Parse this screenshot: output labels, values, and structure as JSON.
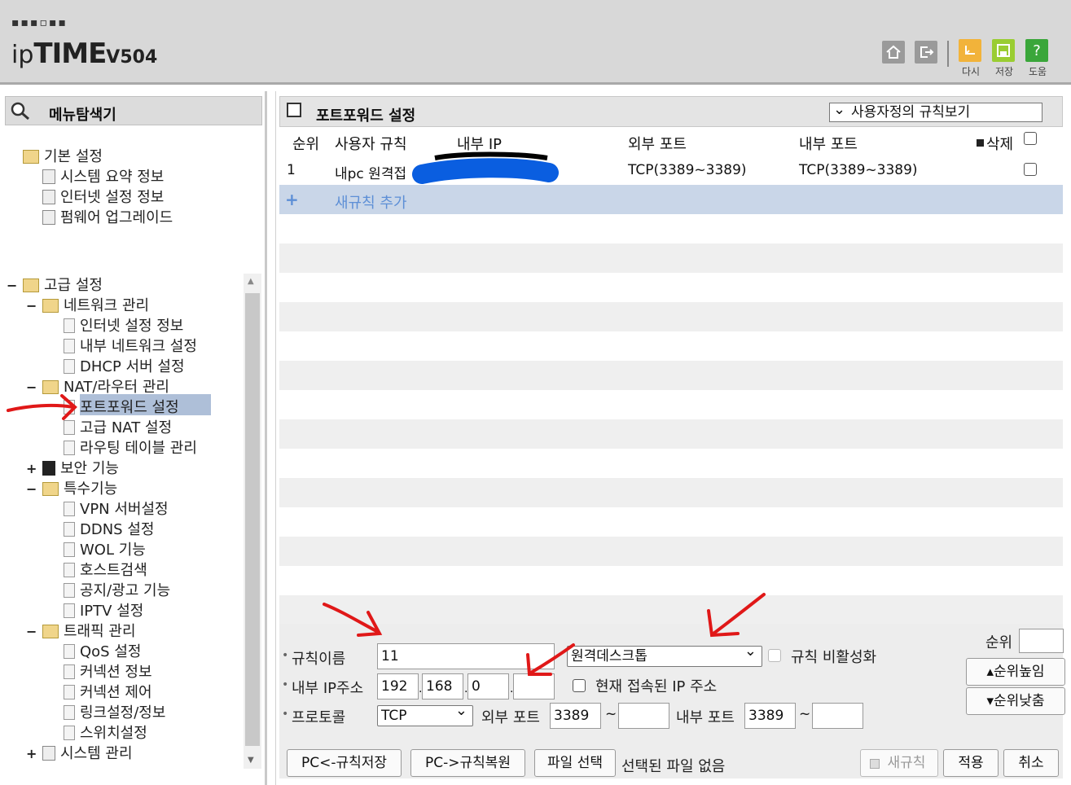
{
  "header": {
    "logo_dots": "▪▪▪▫▪▪",
    "brand_ip": "ip",
    "brand_time": "TIME",
    "model": "V504",
    "buttons": [
      {
        "icon": "home-icon",
        "label": ""
      },
      {
        "icon": "logout-icon",
        "label": ""
      },
      {
        "icon": "reload-icon",
        "label": "다시"
      },
      {
        "icon": "save-icon",
        "label": "저장"
      },
      {
        "icon": "help-icon",
        "label": "도움",
        "glyph": "?"
      }
    ]
  },
  "sidebar": {
    "title": "메뉴탐색기",
    "basic": {
      "label": "기본 설정",
      "items": [
        "시스템 요약 정보",
        "인터넷 설정 정보",
        "펌웨어 업그레이드"
      ]
    },
    "advanced": {
      "label": "고급 설정",
      "toggle": "−",
      "groups": [
        {
          "label": "네트워크 관리",
          "toggle": "−",
          "items": [
            "인터넷 설정 정보",
            "내부 네트워크 설정",
            "DHCP 서버 설정"
          ]
        },
        {
          "label": "NAT/라우터 관리",
          "toggle": "−",
          "items": [
            "포트포워드 설정",
            "고급 NAT 설정",
            "라우팅 테이블 관리"
          ]
        },
        {
          "label": "보안 기능",
          "toggle": "+",
          "items": []
        },
        {
          "label": "특수기능",
          "toggle": "−",
          "items": [
            "VPN 서버설정",
            "DDNS 설정",
            "WOL 기능",
            "호스트검색",
            "공지/광고 기능",
            "IPTV 설정"
          ]
        },
        {
          "label": "트래픽 관리",
          "toggle": "−",
          "items": [
            "QoS 설정",
            "커넥션 정보",
            "커넥션 제어",
            "링크설정/정보",
            "스위치설정"
          ]
        },
        {
          "label": "시스템 관리",
          "toggle": "+",
          "items": []
        }
      ]
    }
  },
  "main": {
    "title": "포트포워드 설정",
    "view_select": "사용자정의 규칙보기",
    "columns": {
      "order": "순위",
      "rule": "사용자 규칙",
      "internal_ip": "내부 IP",
      "external_port": "외부 포트",
      "internal_port": "내부 포트",
      "delete": "삭제"
    },
    "rows": [
      {
        "order": "1",
        "rule": "내pc 원격접",
        "internal_ip": "",
        "external_port": "TCP(3389~3389)",
        "internal_port": "TCP(3389~3389)"
      }
    ],
    "add_rule": "새규칙 추가",
    "add_icon": "+"
  },
  "form": {
    "rule_name_label": "규칙이름",
    "rule_name_value": "11",
    "service_select": "원격데스크톱",
    "disable_label": "규칙 비활성화",
    "ip_label": "내부 IP주소",
    "ip": [
      "192",
      "168",
      "0",
      ""
    ],
    "current_ip_label": "현재 접속된 IP 주소",
    "protocol_label": "프로토콜",
    "protocol_value": "TCP",
    "ext_port_label": "외부 포트",
    "ext_port_from": "3389",
    "ext_port_to": "",
    "int_port_label": "내부 포트",
    "int_port_from": "3389",
    "int_port_to": "",
    "tilde": "~",
    "order_label": "순위",
    "order_value": "",
    "order_up": "▴순위높임",
    "order_down": "▾순위낮춤",
    "btn_pc_save": "PC<-규칙저장",
    "btn_pc_restore": "PC->규칙복원",
    "btn_file": "파일 선택",
    "file_status": "선택된 파일 없음",
    "btn_new_rule": "새규칙",
    "btn_apply": "적용",
    "btn_cancel": "취소"
  },
  "colors": {
    "annotation": "#e01818",
    "redaction": "#0a5ee0",
    "highlight": "#aebfd8"
  }
}
